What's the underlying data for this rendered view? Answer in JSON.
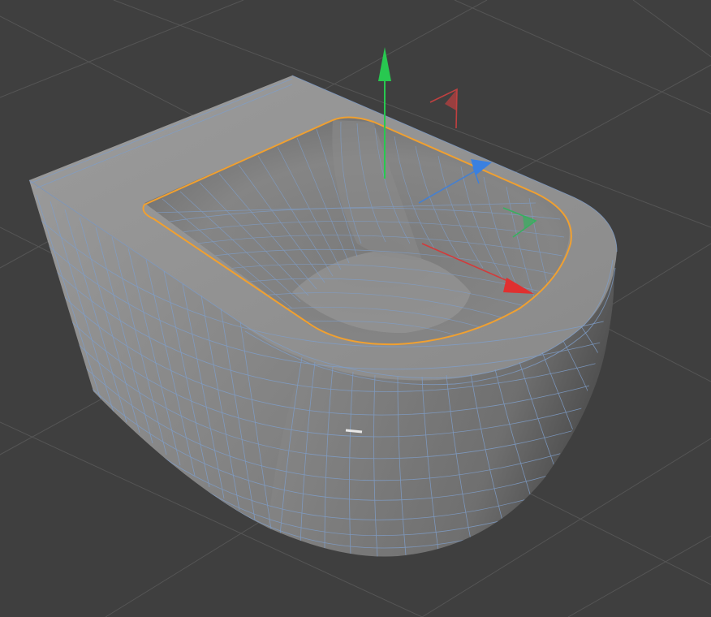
{
  "viewport": {
    "background_color": "#3f3f3f",
    "grid_color": "#565656",
    "mesh_body_color": "#7a7a7a",
    "mesh_top_color": "#8c8c8c",
    "wireframe_color": "#7f9ec9",
    "selection_color": "#f0a030",
    "axis_y_color": "#28c850",
    "axis_x_color": "#e03030",
    "axis_z_color": "#3a80e0"
  },
  "gizmo": {
    "axes": [
      "y-axis-handle",
      "x-axis-handle",
      "z-axis-handle"
    ]
  }
}
